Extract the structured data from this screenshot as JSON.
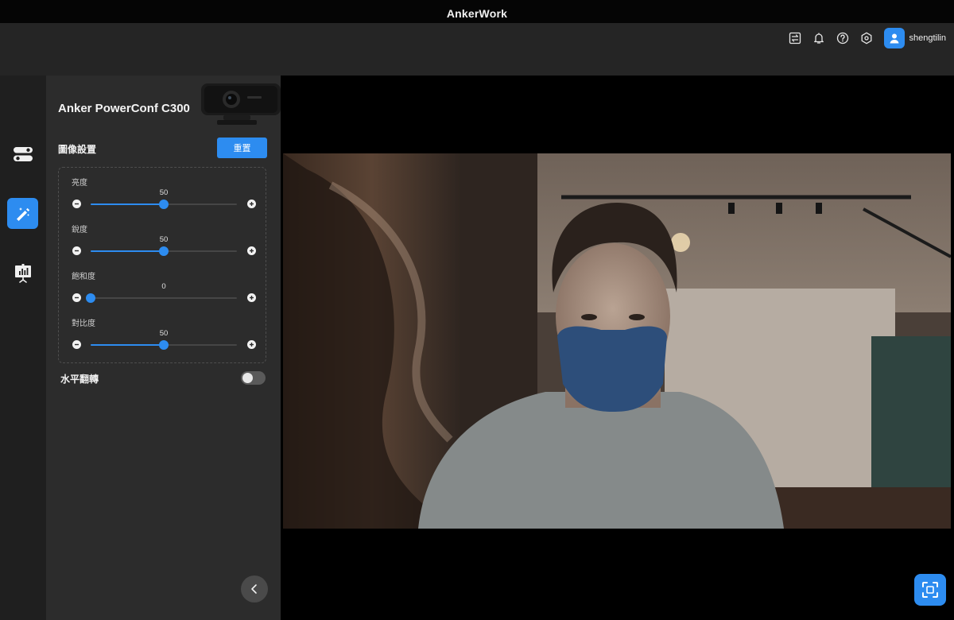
{
  "app": {
    "title": "AnkerWork"
  },
  "header": {
    "icons": [
      "switch-icon",
      "bell-icon",
      "help-icon",
      "settings-icon"
    ],
    "user": {
      "name": "shengtilin",
      "avatar_icon": "user-icon"
    }
  },
  "sidebar": {
    "items": [
      {
        "icon": "device-controls-icon",
        "active": false
      },
      {
        "icon": "image-settings-icon",
        "active": true
      },
      {
        "icon": "presentation-stats-icon",
        "active": false
      }
    ]
  },
  "panel": {
    "device_name": "Anker PowerConf C300",
    "section_title": "圖像設置",
    "reset_label": "重置",
    "sliders": [
      {
        "label": "亮度",
        "value": "50",
        "level": 0.5
      },
      {
        "label": "銳度",
        "value": "50",
        "level": 0.5
      },
      {
        "label": "飽和度",
        "value": "0",
        "level": 0.0
      },
      {
        "label": "對比度",
        "value": "50",
        "level": 0.5
      }
    ],
    "mirror": {
      "label": "水平翻轉",
      "enabled": false
    }
  },
  "colors": {
    "accent": "#2d8cf0",
    "panel": "#2c2c2c",
    "rail": "#1f1f1f",
    "appbar": "#252525"
  }
}
